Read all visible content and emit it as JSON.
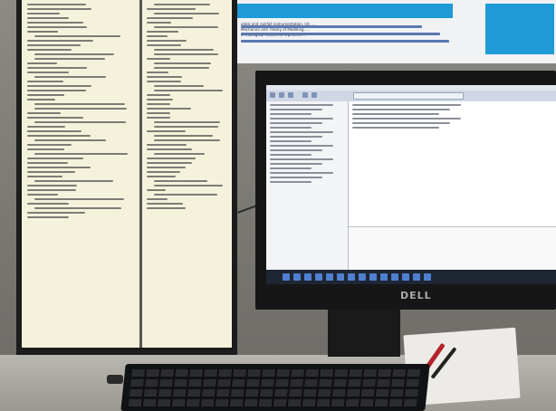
{
  "poster": {
    "text": "odels and rainfall instrumentation. Int. ...\nMechanics and Theory of Modeling. ...\nof ecological models to represent ..."
  },
  "portrait_monitor": {
    "left_pane_lines": 48,
    "right_pane_lines": 46
  },
  "landscape_monitor": {
    "brand": "DELL"
  },
  "colors": {
    "screen_bg": "#f5f2dc",
    "bezel": "#1c1c1d",
    "poster_accent": "#1f9ad6"
  }
}
